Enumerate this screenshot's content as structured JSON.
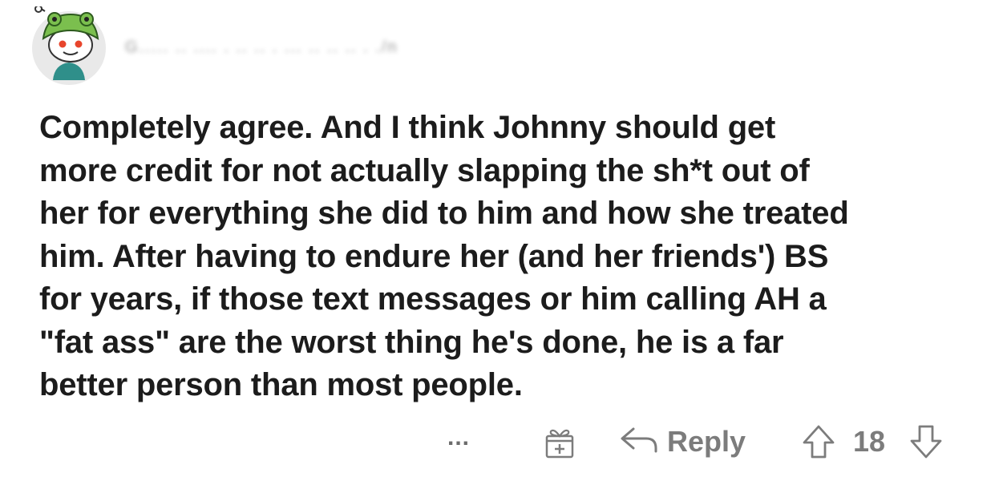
{
  "comment": {
    "username": "G..... .. ....  .   .. .. . ... .. ..  .. . ./n",
    "body": "Completely agree. And I think Johnny should get\nmore credit for not actually slapping the sh*t out of\nher for everything she did to him and how she treated\nhim. After having to endure her (and her friends') BS\nfor years, if those text messages or him calling AH a\n\"fat ass\" are the worst thing he's done, he is a far\nbetter person than most people."
  },
  "actions": {
    "more_label": "...",
    "reply_label": "Reply",
    "vote_count": "18"
  },
  "icons": {
    "avatar": "snoo-frog-hat-avatar",
    "award": "gift-award-icon",
    "reply": "reply-arrow-icon",
    "upvote": "arrow-up-icon",
    "downvote": "arrow-down-icon"
  },
  "colors": {
    "text": "#1c1c1c",
    "meta": "#7c7c7c",
    "avatar_bg": "#e8e8e8",
    "frog_green": "#6fb84a"
  }
}
